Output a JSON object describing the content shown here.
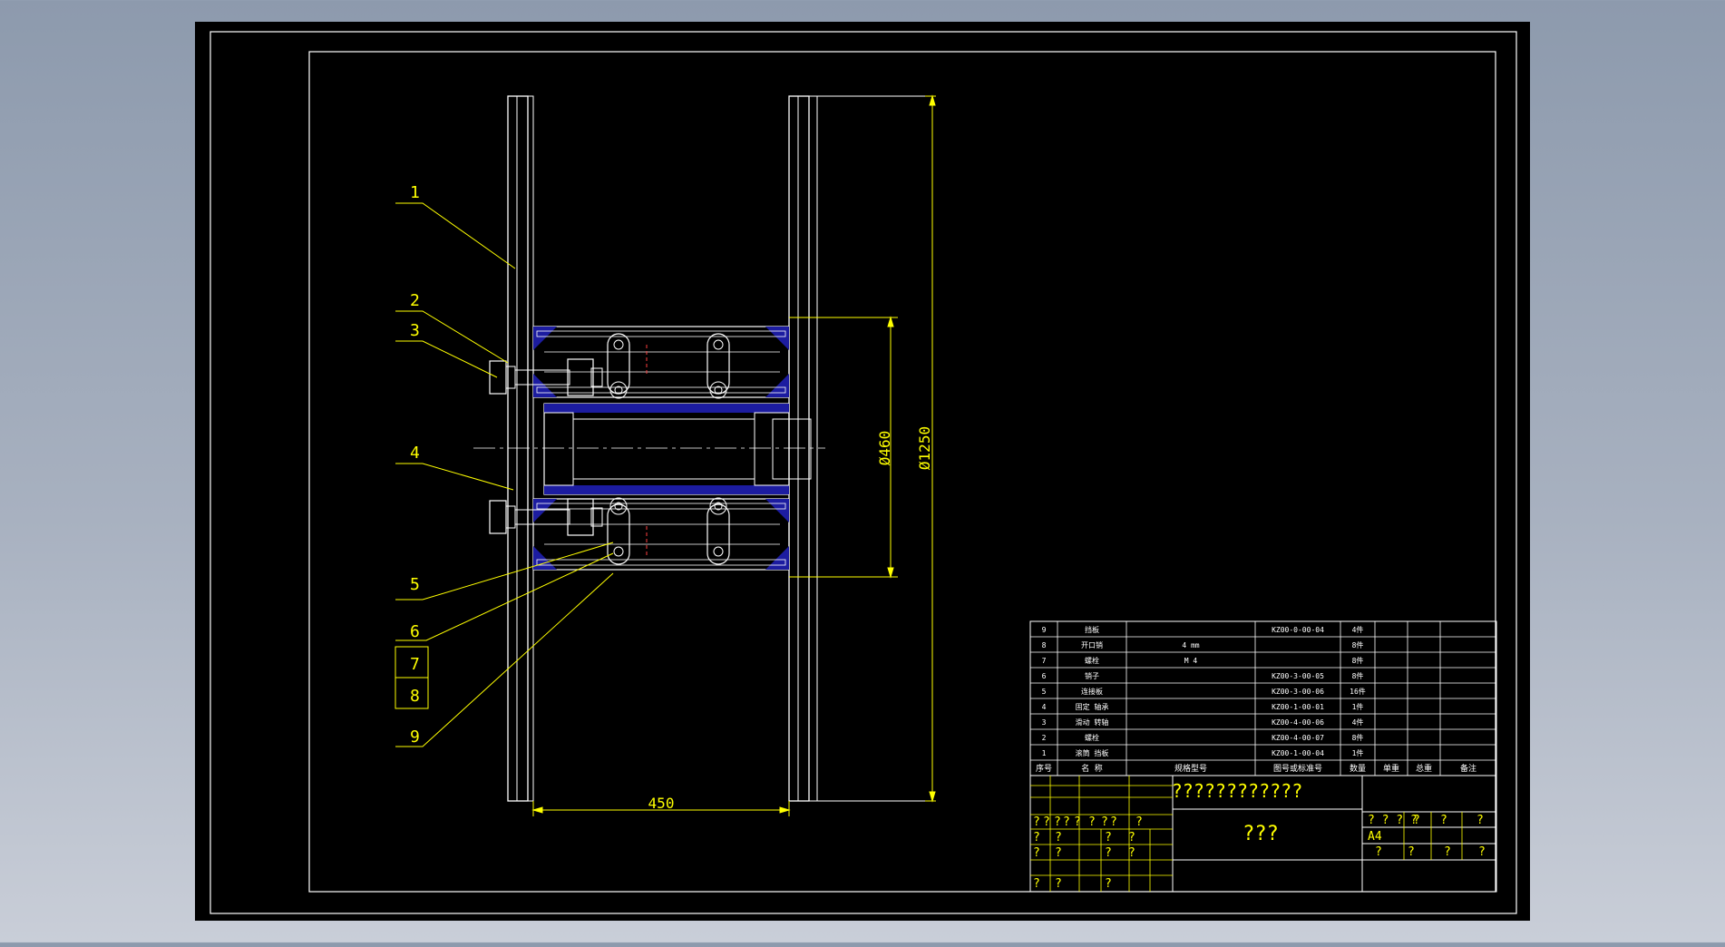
{
  "drawing": {
    "dimensions": {
      "length": "450",
      "inner_diameter": "Ø460",
      "outer_diameter": "Ø1250"
    },
    "balloons": [
      "1",
      "2",
      "3",
      "4",
      "5",
      "6",
      "7",
      "8",
      "9"
    ],
    "bom": {
      "headers": [
        "序号",
        "名 称",
        "规格型号",
        "图号或标准号",
        "数量",
        "单重",
        "总重",
        "备注"
      ],
      "rows": [
        {
          "no": "9",
          "name": "挡板",
          "spec": "",
          "code": "KZ00-0-00-04",
          "qty": "4件"
        },
        {
          "no": "8",
          "name": "开口销",
          "spec": "4 mm",
          "code": "",
          "qty": "8件"
        },
        {
          "no": "7",
          "name": "螺栓",
          "spec": "M 4",
          "code": "",
          "qty": "8件"
        },
        {
          "no": "6",
          "name": "销子",
          "spec": "",
          "code": "KZ00-3-00-05",
          "qty": "8件"
        },
        {
          "no": "5",
          "name": "连接板",
          "spec": "",
          "code": "KZ00-3-00-06",
          "qty": "16件"
        },
        {
          "no": "4",
          "name": "固定 轴承",
          "spec": "",
          "code": "KZ00-1-00-01",
          "qty": "1件"
        },
        {
          "no": "3",
          "name": "滑动 转轴",
          "spec": "",
          "code": "KZ00-4-00-06",
          "qty": "4件"
        },
        {
          "no": "2",
          "name": "螺栓",
          "spec": "",
          "code": "KZ00-4-00-07",
          "qty": "8件"
        },
        {
          "no": "1",
          "name": "滚筒 挡板",
          "spec": "",
          "code": "KZ00-1-00-04",
          "qty": "1件"
        }
      ]
    },
    "title_block": {
      "project_title": "????????????",
      "drawing_name": "???",
      "sheet_size": "A4",
      "left_rows": [
        [
          "?",
          "?",
          "?",
          "?",
          "?",
          "?",
          "?",
          "?",
          "?"
        ],
        [
          "?",
          "?",
          "?",
          "?"
        ],
        [
          "?",
          "?",
          "?",
          "?"
        ],
        [
          "?",
          "?",
          "?"
        ]
      ],
      "right_top_cells": [
        "? ? ? ?",
        "?",
        "?",
        "?"
      ],
      "right_bottom_cells": [
        "?",
        "?",
        "?",
        "?"
      ]
    }
  }
}
